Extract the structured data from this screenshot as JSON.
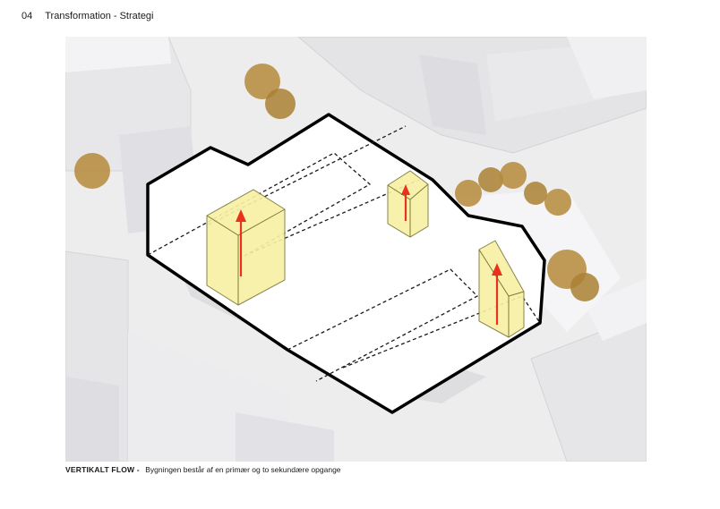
{
  "header": {
    "page_number": "04",
    "title": "Transformation - Strategi"
  },
  "caption": {
    "label": "VERTIKALT FLOW -",
    "text": "Bygningen består af en primær og to sekundære opgange"
  },
  "colors": {
    "site_fill": "#ffffff",
    "site_outline": "#000000",
    "stair_fill": "#f7f0a6",
    "stair_stroke": "#7d7a3a",
    "arrow": "#e8321e",
    "tree": "#b58a3a",
    "context": "#e9e8ea"
  },
  "icons": {
    "arrow": "arrow-up-icon",
    "tree": "tree-icon"
  }
}
